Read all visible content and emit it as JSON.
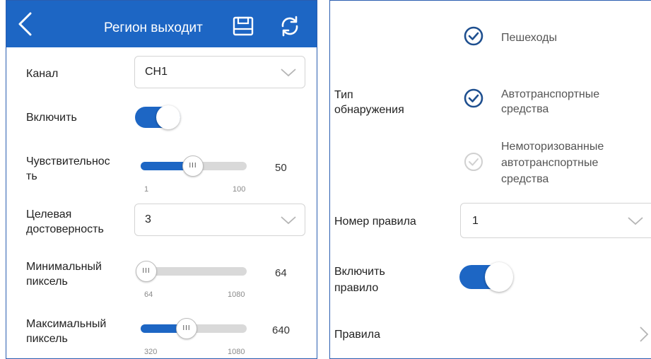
{
  "header": {
    "title": "Регион выходит"
  },
  "left": {
    "channel": {
      "label": "Канал",
      "value": "CH1"
    },
    "enable": {
      "label": "Включить",
      "on": true
    },
    "sensitivity": {
      "label_line1": "Чувствительнос",
      "label_line2": "ть",
      "value": "50",
      "min": "1",
      "max": "100",
      "fraction": 0.49
    },
    "target_confidence": {
      "label_line1": "Целевая",
      "label_line2": "достоверность",
      "value": "3"
    },
    "min_pixel": {
      "label_line1": "Минимальный",
      "label_line2": "пиксель",
      "value": "64",
      "min": "64",
      "max": "1080",
      "fraction": 0.0
    },
    "max_pixel": {
      "label_line1": "Максимальный",
      "label_line2": "пиксель",
      "value": "640",
      "min": "320",
      "max": "1080",
      "fraction": 0.42
    }
  },
  "right": {
    "detection_type": {
      "label_line1": "Тип",
      "label_line2": "обнаружения",
      "options": [
        {
          "line1": "Пешеходы",
          "line2": "",
          "line3": "",
          "checked": true,
          "enabled": true
        },
        {
          "line1": "Автотранспортные",
          "line2": "средства",
          "line3": "",
          "checked": true,
          "enabled": true
        },
        {
          "line1": "Немоторизованные",
          "line2": "автотранспортные",
          "line3": "средства",
          "checked": false,
          "enabled": false
        }
      ]
    },
    "rule_number": {
      "label": "Номер правила",
      "value": "1"
    },
    "enable_rule": {
      "label_line1": "Включить",
      "label_line2": "правило",
      "on": true
    },
    "rules": {
      "label": "Правила"
    }
  },
  "colors": {
    "accent": "#1d66c4",
    "track_off": "#d9d9d9",
    "border": "#d4d4d4",
    "check_disabled": "#d0d0d0"
  },
  "icons": {
    "back": "chevron-left-icon",
    "save": "save-icon",
    "refresh": "refresh-icon",
    "dropdown": "chevron-down-icon",
    "check": "check-circle-icon",
    "next": "chevron-right-icon"
  }
}
